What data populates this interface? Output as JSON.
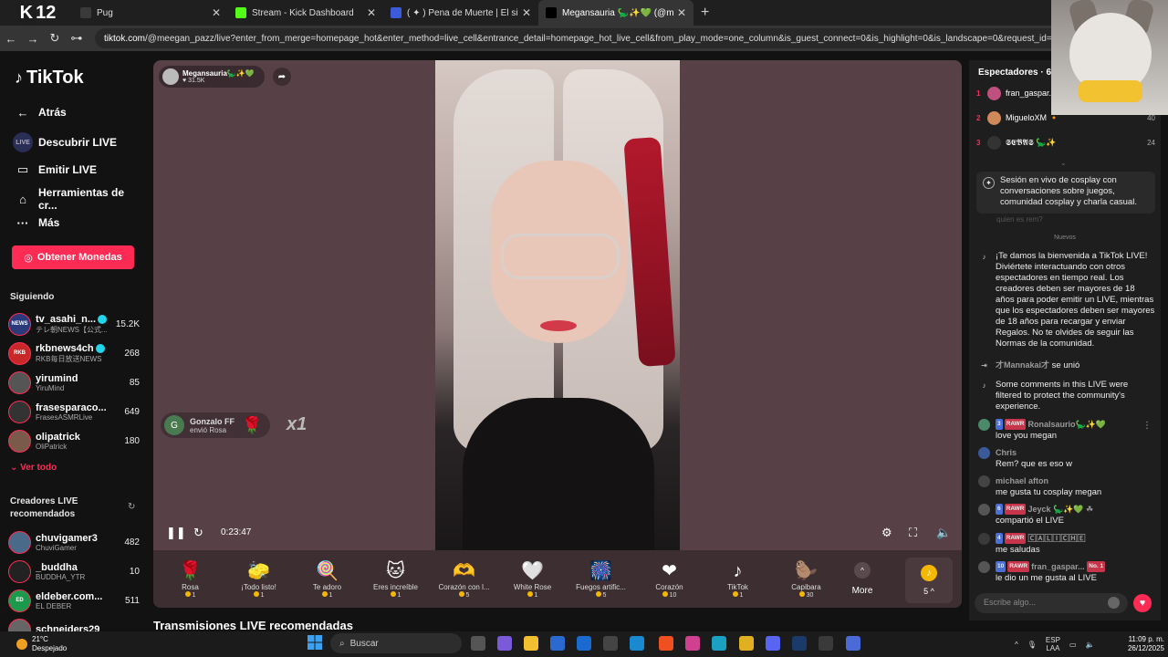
{
  "browser": {
    "k12_label": "12",
    "k12_letter": "K",
    "tabs": [
      {
        "title": "Pug",
        "fav_color": "#3a3a3a"
      },
      {
        "title": "Stream - Kick Dashboard",
        "fav_color": "#53fc18"
      },
      {
        "title": "( ✦ ) Pena de Muerte | El sitio w",
        "fav_color": "#3b5bdb"
      },
      {
        "title": "Megansauria 🦕✨💚 (@m",
        "fav_color": "#000000"
      }
    ],
    "new_tab": "+",
    "url_host": "tiktok.com",
    "url_rest": "/@meegan_pazz/live?enter_from_merge=homepage_hot&enter_method=live_cell&entrance_detail=homepage_hot_live_cell&from_play_mode=one_column&is_guest_connect=0&is_highlight=0&is_landscape=0&request_id=20251227120..."
  },
  "sidebar": {
    "logo": "TikTok",
    "back": "Atrás",
    "nav": [
      {
        "label": "Descubrir LIVE",
        "icon": "LIVE"
      },
      {
        "label": "Emitir LIVE",
        "icon": "▭"
      },
      {
        "label": "Herramientas de cr...",
        "icon": "⌂"
      },
      {
        "label": "Más",
        "icon": "···"
      }
    ],
    "coins_button": "Obtener Monedas",
    "following_title": "Siguiendo",
    "following": [
      {
        "name": "tv_asahi_n...",
        "sub": "テレ朝NEWS【公式...",
        "count": "15.2K",
        "verified": true,
        "color": "#2a3a7a",
        "tag": "NEWS"
      },
      {
        "name": "rkbnews4ch",
        "sub": "RKB毎日放送NEWS",
        "count": "268",
        "verified": true,
        "color": "#c82828",
        "tag": "RKB"
      },
      {
        "name": "yirumind",
        "sub": "YiruMind",
        "count": "85",
        "verified": false,
        "color": "#555555",
        "tag": ""
      },
      {
        "name": "frasesparaco...",
        "sub": "FrasesASMRLive",
        "count": "649",
        "verified": false,
        "color": "#333333",
        "tag": ""
      },
      {
        "name": "olipatrick",
        "sub": "OliPatrick",
        "count": "180",
        "verified": false,
        "color": "#7a5a4a",
        "tag": ""
      }
    ],
    "see_all": "Ver todo",
    "recommended_title": "Creadores LIVE recomendados",
    "recommended": [
      {
        "name": "chuvigamer3",
        "sub": "ChuviGamer",
        "count": "482",
        "color": "#4a6a8a",
        "tag": ""
      },
      {
        "name": "_buddha",
        "sub": "BUDDHA_YTR",
        "count": "10",
        "color": "#222222",
        "tag": ""
      },
      {
        "name": "eldeber.com...",
        "sub": "EL DEBER",
        "count": "511",
        "color": "#1a9a4a",
        "tag": "ED"
      },
      {
        "name": "schneiders29",
        "sub": "",
        "count": "",
        "color": "#666666",
        "tag": ""
      }
    ]
  },
  "player": {
    "host_name": "Megansauria🦕✨💚",
    "host_likes": "♥ 31.5K",
    "gift_notice_user": "Gonzalo FF",
    "gift_notice_text": "envió Rosa",
    "gift_notice_avatar": "G",
    "gift_multiplier": "x1",
    "elapsed": "0:23:47",
    "gifts": [
      {
        "name": "Rosa",
        "price": "1",
        "icon": "🌹"
      },
      {
        "name": "¡Todo listo!",
        "price": "1",
        "icon": "🧽"
      },
      {
        "name": "Te adoro",
        "price": "1",
        "icon": "🍭"
      },
      {
        "name": "Eres increíble",
        "price": "1",
        "icon": "🐱"
      },
      {
        "name": "Corazón con l...",
        "price": "5",
        "icon": "🫶"
      },
      {
        "name": "White Rose",
        "price": "1",
        "icon": "🤍"
      },
      {
        "name": "Fuegos artific...",
        "price": "5",
        "icon": "🎆"
      },
      {
        "name": "Corazón",
        "price": "10",
        "icon": "❤"
      },
      {
        "name": "TikTok",
        "price": "1",
        "icon": "♪"
      },
      {
        "name": "Capibara",
        "price": "30",
        "icon": "🦫"
      }
    ],
    "more_label": "More",
    "coin_balance": "5 ^"
  },
  "recommended_heading": "Transmisiones LIVE recomendadas",
  "chat": {
    "viewers_title": "Espectadores · 64",
    "top_viewers": [
      {
        "rank": "1",
        "name": "fran_gaspar...",
        "score": "",
        "color": "#c05080"
      },
      {
        "rank": "2",
        "name": "MigueloXM 🔸",
        "score": "40",
        "color": "#d08a5a"
      },
      {
        "rank": "3",
        "name": "𝕾𝕰𝕭𝕬𝕾 🦕✨",
        "score": "24",
        "color": "#333333"
      }
    ],
    "summary": "Sesión en vivo de cosplay con conversaciones sobre juegos, comunidad cosplay y charla casual.",
    "faded_text": "quien es rem?",
    "new_label": "Nuevos",
    "welcome": "¡Te damos la bienvenida a TikTok LIVE! Diviértete interactuando con otros espectadores en tiempo real. Los creadores deben ser mayores de 18 años para poder emitir un LIVE, mientras que los espectadores deben ser mayores de 18 años para recargar y enviar Regalos. No te olvides de seguir las Normas de la comunidad.",
    "joined_user": "才Mannakai才",
    "joined_text": "se unió",
    "filter_notice": "Some comments in this LIVE were filtered to protect the community's experience.",
    "messages": [
      {
        "badges": [
          "3",
          "RAWR"
        ],
        "user": "Ronalsaurio🦕✨💚",
        "text": "love you megan",
        "color": "#4a8a6a"
      },
      {
        "badges": [],
        "user": "Chris",
        "text": "Rem? que es eso w",
        "color": "#3a5a9a"
      },
      {
        "badges": [],
        "user": "michael afton",
        "text": "me gusta tu cosplay megan",
        "color": "#444444"
      },
      {
        "badges": [
          "6",
          "RAWR"
        ],
        "user": "Jeyck 🦕✨💚 ☘",
        "text": "compartió el LIVE",
        "color": "#555555"
      },
      {
        "badges": [
          "4",
          "RAWR"
        ],
        "user": "🄲🄰🄻🄸🄲🄷🄴",
        "text": "me saludas",
        "color": "#3a3a3a"
      },
      {
        "badges": [
          "10",
          "RAWR"
        ],
        "user": "fran_gaspar...",
        "text": "le dio un me gusta al LIVE",
        "color": "#555555",
        "extra_badge": "No. 1"
      }
    ],
    "input_placeholder": "Escribe algo..."
  },
  "taskbar": {
    "temp": "21°C",
    "weather": "Despejado",
    "search_placeholder": "Buscar",
    "lang1": "ESP",
    "lang2": "LAA",
    "time": "11:09 p. m.",
    "date": "26/12/2025"
  }
}
